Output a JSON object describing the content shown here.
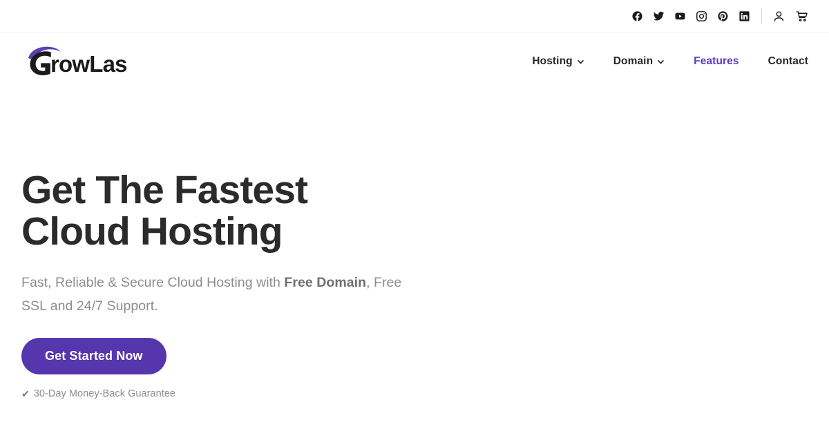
{
  "site": {
    "brand_name": "GrowLast",
    "brand_mark_color": "#5b3fb3",
    "brand_text_color": "#1b1b1b"
  },
  "topbar": {
    "social": [
      {
        "name": "facebook-icon",
        "label": "Facebook"
      },
      {
        "name": "twitter-icon",
        "label": "Twitter"
      },
      {
        "name": "youtube-icon",
        "label": "YouTube"
      },
      {
        "name": "instagram-icon",
        "label": "Instagram"
      },
      {
        "name": "pinterest-icon",
        "label": "Pinterest"
      },
      {
        "name": "linkedin-icon",
        "label": "LinkedIn"
      }
    ],
    "utilities": [
      {
        "name": "account-icon",
        "label": "Account"
      },
      {
        "name": "cart-icon",
        "label": "Cart"
      }
    ]
  },
  "nav": {
    "items": [
      {
        "label": "Hosting",
        "has_dropdown": true,
        "active": false
      },
      {
        "label": "Domain",
        "has_dropdown": true,
        "active": false
      },
      {
        "label": "Features",
        "has_dropdown": false,
        "active": true
      },
      {
        "label": "Contact",
        "has_dropdown": false,
        "active": false
      }
    ],
    "active_color": "#5a38c4"
  },
  "hero": {
    "title_line1": "Get The Fastest",
    "title_line2": "Cloud Hosting",
    "subtitle_part1": "Fast, Reliable & Secure Cloud Hosting with ",
    "subtitle_strong": "Free Domain",
    "subtitle_part2": ", Free SSL and 24/7 Support.",
    "cta_label": "Get Started Now",
    "cta_color": "#5636ad",
    "guarantee_check": "✔",
    "guarantee_text": "30-Day Money-Back Guarantee"
  }
}
